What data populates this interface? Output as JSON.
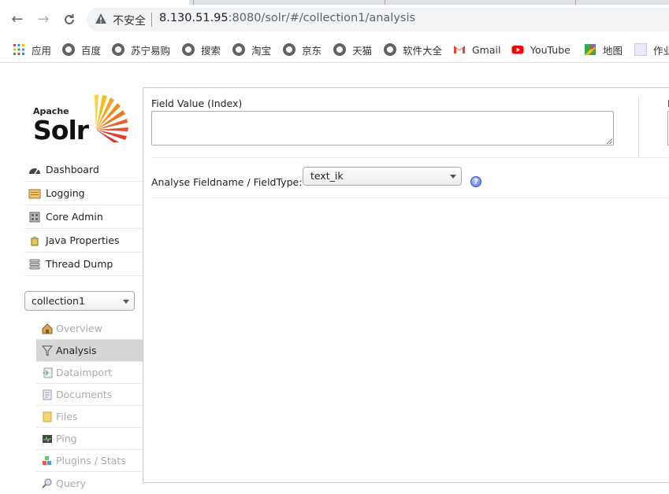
{
  "browser": {
    "security_label": "不安全",
    "url_host": "8.130.51.95",
    "url_rest": ":8080/solr/#/collection1/analysis"
  },
  "bookmarks": [
    {
      "label": "应用",
      "icon": "apps-grid-icon"
    },
    {
      "label": "百度",
      "icon": "globe-icon"
    },
    {
      "label": "苏宁易购",
      "icon": "globe-icon"
    },
    {
      "label": "搜索",
      "icon": "globe-icon"
    },
    {
      "label": "淘宝",
      "icon": "globe-icon"
    },
    {
      "label": "京东",
      "icon": "globe-icon"
    },
    {
      "label": "天猫",
      "icon": "globe-icon"
    },
    {
      "label": "软件大全",
      "icon": "globe-icon"
    },
    {
      "label": "Gmail",
      "icon": "gmail-icon"
    },
    {
      "label": "YouTube",
      "icon": "youtube-icon"
    },
    {
      "label": "地图",
      "icon": "maps-icon"
    },
    {
      "label": "作业",
      "icon": "folder-icon"
    }
  ],
  "solr": {
    "logo_top": "Apache",
    "logo_main": "Solr",
    "menu": [
      {
        "label": "Dashboard",
        "icon": "dashboard-icon"
      },
      {
        "label": "Logging",
        "icon": "logging-icon"
      },
      {
        "label": "Core Admin",
        "icon": "core-admin-icon"
      },
      {
        "label": "Java Properties",
        "icon": "java-properties-icon"
      },
      {
        "label": "Thread Dump",
        "icon": "thread-dump-icon"
      }
    ],
    "core_selector": "collection1",
    "core_menu": [
      {
        "label": "Overview",
        "icon": "overview-icon",
        "active": false
      },
      {
        "label": "Analysis",
        "icon": "analysis-funnel-icon",
        "active": true
      },
      {
        "label": "Dataimport",
        "icon": "dataimport-icon",
        "active": false
      },
      {
        "label": "Documents",
        "icon": "documents-icon",
        "active": false
      },
      {
        "label": "Files",
        "icon": "files-icon",
        "active": false
      },
      {
        "label": "Ping",
        "icon": "ping-icon",
        "active": false
      },
      {
        "label": "Plugins / Stats",
        "icon": "plugins-icon",
        "active": false
      },
      {
        "label": "Query",
        "icon": "query-icon",
        "active": false
      }
    ]
  },
  "analysis": {
    "field_value_index_label": "Field Value (Index)",
    "field_value_index_value": "",
    "field_value_query_label": "F",
    "fieldtype_label": "Analyse Fieldname / FieldType:",
    "fieldtype_value": "text_ik",
    "help_glyph": "?"
  }
}
